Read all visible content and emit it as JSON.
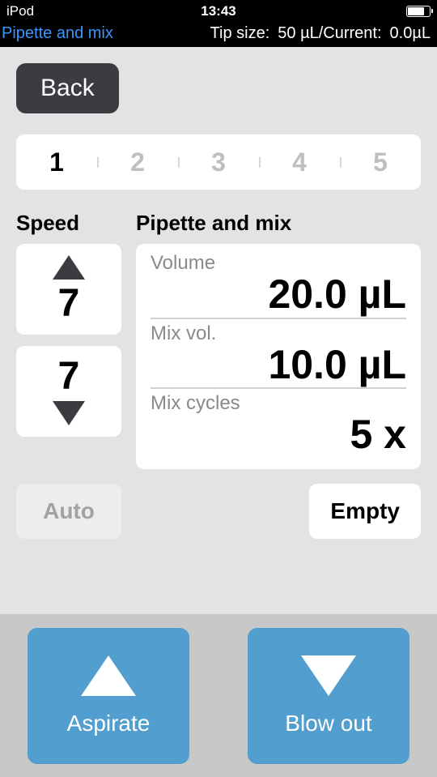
{
  "status": {
    "device": "iPod",
    "time": "13:43"
  },
  "info": {
    "title": "Pipette and mix",
    "tip_size_label": "Tip size:",
    "tip_size_value": "50 µL/Current:",
    "current_value": "0.0µL"
  },
  "back_label": "Back",
  "steps": [
    "1",
    "2",
    "3",
    "4",
    "5"
  ],
  "active_step": 0,
  "speed": {
    "label": "Speed",
    "up_value": "7",
    "down_value": "7"
  },
  "pipette": {
    "label": "Pipette and mix",
    "volume_label": "Volume",
    "volume_value": "20.0 µL",
    "mixvol_label": "Mix vol.",
    "mixvol_value": "10.0 µL",
    "cycles_label": "Mix cycles",
    "cycles_value": "5 x"
  },
  "aux": {
    "auto_label": "Auto",
    "empty_label": "Empty"
  },
  "actions": {
    "aspirate_label": "Aspirate",
    "blowout_label": "Blow out"
  }
}
